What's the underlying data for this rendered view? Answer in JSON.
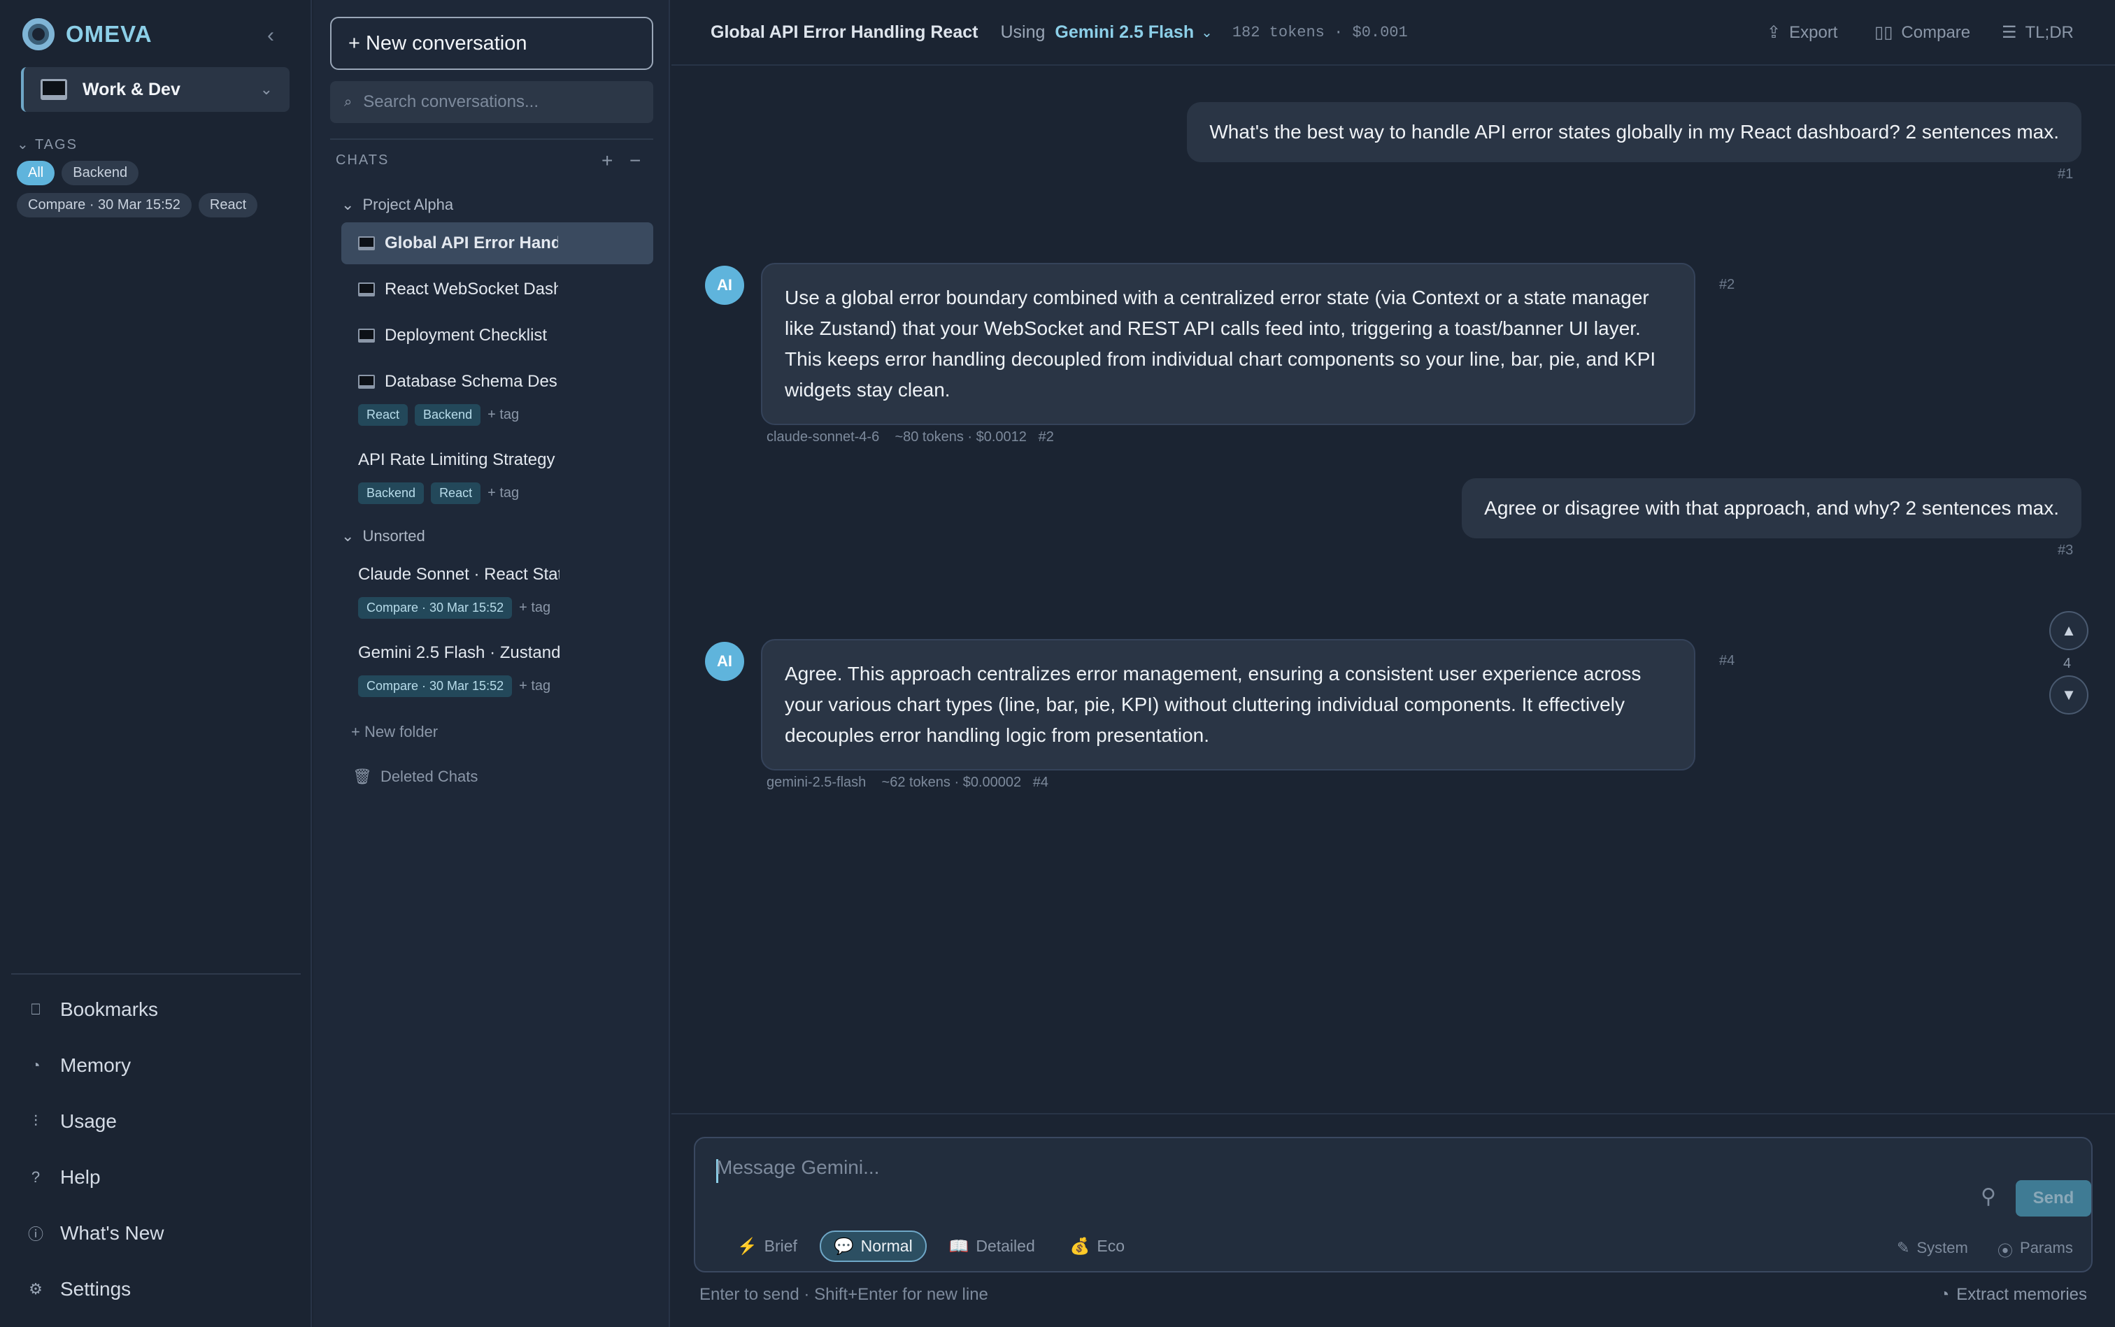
{
  "sidebar": {
    "brand": "OMEVA",
    "workspace": "Work & Dev",
    "tags_heading": "TAGS",
    "tags": [
      "All",
      "Backend",
      "Compare · 30 Mar 15:52",
      "React"
    ],
    "nav": [
      {
        "label": "Bookmarks",
        "icon": "bookmark-icon"
      },
      {
        "label": "Memory",
        "icon": "memory-icon"
      },
      {
        "label": "Usage",
        "icon": "usage-icon"
      },
      {
        "label": "Help",
        "icon": "help-icon"
      },
      {
        "label": "What's New",
        "icon": "info-icon"
      },
      {
        "label": "Settings",
        "icon": "gear-icon"
      }
    ]
  },
  "chats": {
    "new_label": "+ New conversation",
    "search_placeholder": "Search conversations...",
    "heading": "CHATS",
    "folders": [
      {
        "name": "Project Alpha",
        "items": [
          {
            "title": "Global API Error Handling React",
            "tags": []
          },
          {
            "title": "React WebSocket Dashboard",
            "tags": []
          },
          {
            "title": "Deployment Checklist",
            "tags": []
          },
          {
            "title": "Database Schema Design",
            "tags": [
              "React",
              "Backend"
            ]
          },
          {
            "title": "API Rate Limiting Strategy",
            "tags": [
              "Backend",
              "React"
            ]
          }
        ]
      },
      {
        "name": "Unsorted",
        "items": [
          {
            "title": "Claude Sonnet · React State",
            "tags": [
              "Compare · 30 Mar 15:52"
            ]
          },
          {
            "title": "Gemini 2.5 Flash · Zustand",
            "tags": [
              "Compare · 30 Mar 15:52"
            ]
          }
        ]
      }
    ],
    "add_tag": "+ tag",
    "new_folder": "+ New folder",
    "deleted": "Deleted Chats"
  },
  "main": {
    "title": "Global API Error Handling React",
    "using": "Using",
    "model": "Gemini 2.5 Flash",
    "tokens": "182 tokens · $0.001",
    "actions": {
      "export": "Export",
      "compare": "Compare",
      "tldr": "TL;DR"
    },
    "messages": [
      {
        "role": "user",
        "text": "What's the best way to handle API error states globally in my React dashboard? 2 sentences max.",
        "num": "#1"
      },
      {
        "role": "ai",
        "avatar": "AI",
        "text": "Use a global error boundary combined with a centralized error state (via Context or a state manager like Zustand) that your WebSocket and REST API calls feed into, triggering a toast/banner UI layer. This keeps error handling decoupled from individual chart components so your line, bar, pie, and KPI widgets stay clean.",
        "num": "#2",
        "meta": "claude-sonnet-4-6    ~80 tokens · $0.0012   #2"
      },
      {
        "role": "user",
        "text": "Agree or disagree with that approach, and why? 2 sentences max.",
        "num": "#3"
      },
      {
        "role": "ai",
        "avatar": "AI",
        "text": "Agree. This approach centralizes error management, ensuring a consistent user experience across your various chart types (line, bar, pie, KPI) without cluttering individual components. It effectively decouples error handling logic from presentation.",
        "num": "#4",
        "meta": "gemini-2.5-flash    ~62 tokens · $0.00002   #4"
      }
    ],
    "scroll_count": "4",
    "composer": {
      "placeholder": "Message Gemini...",
      "send": "Send",
      "modes": [
        {
          "icon": "⚡",
          "label": "Brief"
        },
        {
          "icon": "💬",
          "label": "Normal"
        },
        {
          "icon": "📖",
          "label": "Detailed"
        },
        {
          "icon": "💰",
          "label": "Eco"
        }
      ],
      "system": "System",
      "params": "Params"
    },
    "hint": "Enter to send · Shift+Enter for new line",
    "extract": "Extract memories"
  },
  "colors": {
    "accent": "#5fb4dc",
    "bg": "#1b2432",
    "panel": "#1e2838",
    "bubble": "#2a3545"
  }
}
